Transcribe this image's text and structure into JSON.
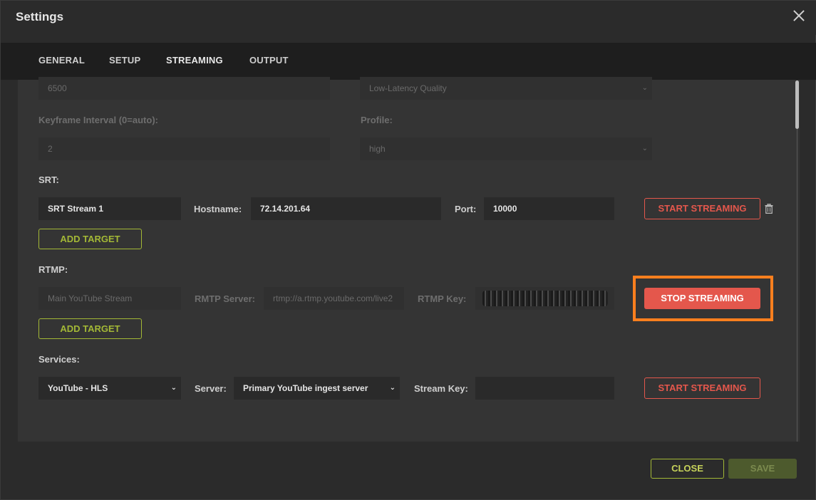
{
  "dialog": {
    "title": "Settings"
  },
  "tabs": [
    {
      "label": "GENERAL"
    },
    {
      "label": "SETUP"
    },
    {
      "label": "STREAMING",
      "active": true
    },
    {
      "label": "OUTPUT"
    }
  ],
  "encoder": {
    "bitrate_value": "6500",
    "quality_value": "Low-Latency Quality",
    "keyframe_label": "Keyframe Interval (0=auto):",
    "keyframe_value": "2",
    "profile_label": "Profile:",
    "profile_value": "high"
  },
  "srt": {
    "section_label": "SRT:",
    "stream_name": "SRT Stream 1",
    "hostname_label": "Hostname:",
    "hostname_value": "72.14.201.64",
    "port_label": "Port:",
    "port_value": "10000",
    "start_label": "START STREAMING",
    "add_target_label": "ADD TARGET"
  },
  "rtmp": {
    "section_label": "RTMP:",
    "stream_name": "Main YouTube Stream",
    "server_label": "RMTP Server:",
    "server_value": "rtmp://a.rtmp.youtube.com/live2",
    "key_label": "RTMP Key:",
    "stop_label": "STOP STREAMING",
    "add_target_label": "ADD TARGET"
  },
  "services": {
    "section_label": "Services:",
    "service_value": "YouTube - HLS",
    "server_label": "Server:",
    "server_value": "Primary YouTube ingest server",
    "key_label": "Stream Key:",
    "key_value": "",
    "start_label": "START STREAMING"
  },
  "footer": {
    "close_label": "CLOSE",
    "save_label": "SAVE"
  },
  "colors": {
    "accent_green": "#a3b836",
    "accent_red": "#e4574c",
    "highlight_orange": "#ff7f1e"
  },
  "icons": [
    "close-icon",
    "trash-icon",
    "chevron-down-icon"
  ]
}
